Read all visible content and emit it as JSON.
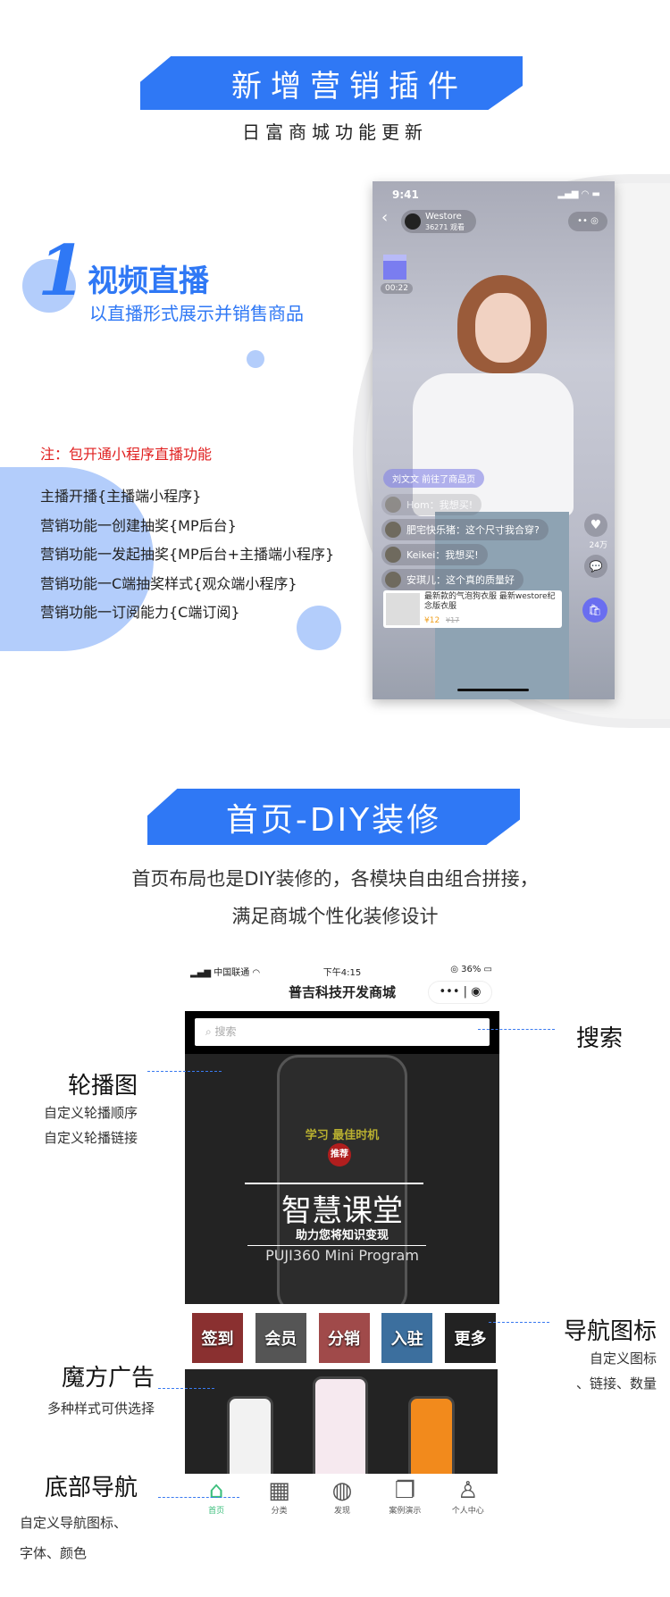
{
  "section1": {
    "title": "新增营销插件",
    "subtitle": "日富商城功能更新"
  },
  "feature": {
    "number": "1",
    "title": "视频直播",
    "subtitle": "以直播形式展示并销售商品",
    "note": "注：包开通小程序直播功能",
    "items": [
      "主播开播{主播端小程序}",
      "营销功能一创建抽奖{MP后台}",
      "营销功能一发起抽奖{MP后台+主播端小程序}",
      "营销功能一C端抽奖样式{观众端小程序}",
      "营销功能一订阅能力{C端订阅}"
    ]
  },
  "live_phone": {
    "time": "9:41",
    "store": "Westore",
    "viewers": "36271 观看",
    "timer": "00:22",
    "notice": "刘文文 前往了商品页",
    "chats": [
      "Hom：我想买!",
      "肥宅快乐猪：这个尺寸我合穿?",
      "Keikei：我想买!",
      "安琪儿：这个真的质量好"
    ],
    "likes": "24万",
    "product": {
      "name": "最新款的气泡狗衣服 最新westore纪念版衣服",
      "price": "¥12",
      "old_price": "¥17"
    }
  },
  "section2": {
    "title": "首页-DIY装修",
    "desc": [
      "首页布局也是DIY装修的，各模块自由组合拼接，",
      "满足商城个性化装修设计"
    ]
  },
  "shop_phone": {
    "carrier": "中国联通",
    "time": "下午4:15",
    "battery": "36%",
    "title": "普吉科技开发商城",
    "search_placeholder": "搜索",
    "banner": {
      "badge": "推荐",
      "title": "智慧课堂",
      "subtitle": "助力您将知识变现",
      "en": "PUJI360  Mini Program",
      "slogan": "学习 最佳时机"
    },
    "nav_icons": [
      "签到",
      "会员",
      "分销",
      "入驻",
      "更多"
    ],
    "tabs": [
      {
        "label": "首页",
        "icon": "store-icon",
        "active": true
      },
      {
        "label": "分类",
        "icon": "grid-icon"
      },
      {
        "label": "发现",
        "icon": "planet-icon"
      },
      {
        "label": "案例演示",
        "icon": "layers-icon"
      },
      {
        "label": "个人中心",
        "icon": "user-icon"
      }
    ],
    "active_color": "#3cbf7c"
  },
  "annotations": {
    "search": {
      "title": "搜索"
    },
    "carousel": {
      "title": "轮播图",
      "lines": [
        "自定义轮播顺序",
        "自定义轮播链接"
      ]
    },
    "nav": {
      "title": "导航图标",
      "lines": [
        "自定义图标",
        "、链接、数量"
      ]
    },
    "cube": {
      "title": "魔方广告",
      "lines": [
        "多种样式可供选择"
      ]
    },
    "tabbar": {
      "title": "底部导航",
      "lines": [
        "自定义导航图标、",
        "字体、颜色"
      ]
    }
  },
  "colors": {
    "brand": "#2f78f5",
    "note": "#e02020",
    "circle": "#b3cdfb"
  }
}
